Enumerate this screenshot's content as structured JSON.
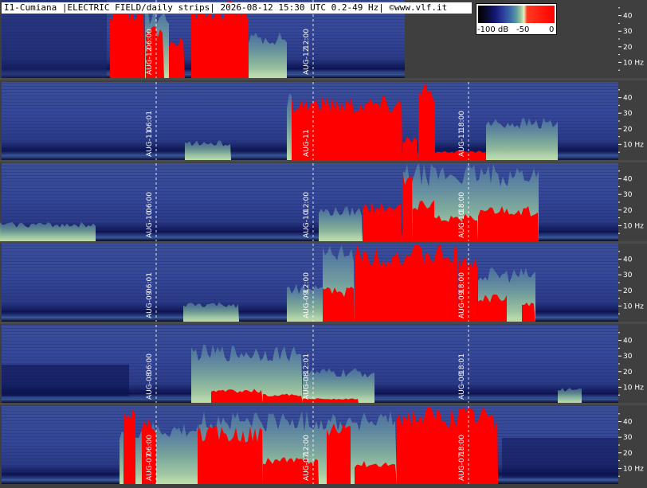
{
  "title": "I1-Cumiana |ELECTRIC FIELD/daily strips| 2026-08-12 15:30 UTC 0.2-49 Hz| ©www.vlf.it",
  "legend": {
    "min_label": "-100 dB",
    "mid_label": "-50",
    "max_label": "0"
  },
  "axis": {
    "ticks": [
      {
        "value": 40,
        "label": "40"
      },
      {
        "value": 30,
        "label": "30"
      },
      {
        "value": 20,
        "label": "20"
      },
      {
        "value": 10,
        "label": "10 Hz"
      }
    ]
  },
  "colors": {
    "background": "#3f3f3f",
    "spectrogram_dark": "#0c1250",
    "spectrogram_blue": "#34469a",
    "spectrogram_green": "#8fc0a0",
    "saturated": "#ff0000",
    "separator": "#4a4a4a",
    "marker_line": "#ffffff"
  },
  "strips": [
    {
      "date_label": "AUG-12",
      "times": [
        "06:00",
        "12:00"
      ]
    },
    {
      "date_label": "AUG-11",
      "times": [
        "06:01",
        "",
        "18:00"
      ]
    },
    {
      "date_label": "AUG-10",
      "times": [
        "06:00",
        "12:00",
        "18:00"
      ]
    },
    {
      "date_label": "AUG-09",
      "times": [
        "06:01",
        "12:00",
        "18:00"
      ]
    },
    {
      "date_label": "AUG-08",
      "times": [
        "06:00",
        "12:01",
        "18:01"
      ]
    },
    {
      "date_label": "AUG-07",
      "times": [
        "06:00",
        "12:00",
        "18:00"
      ]
    }
  ]
}
